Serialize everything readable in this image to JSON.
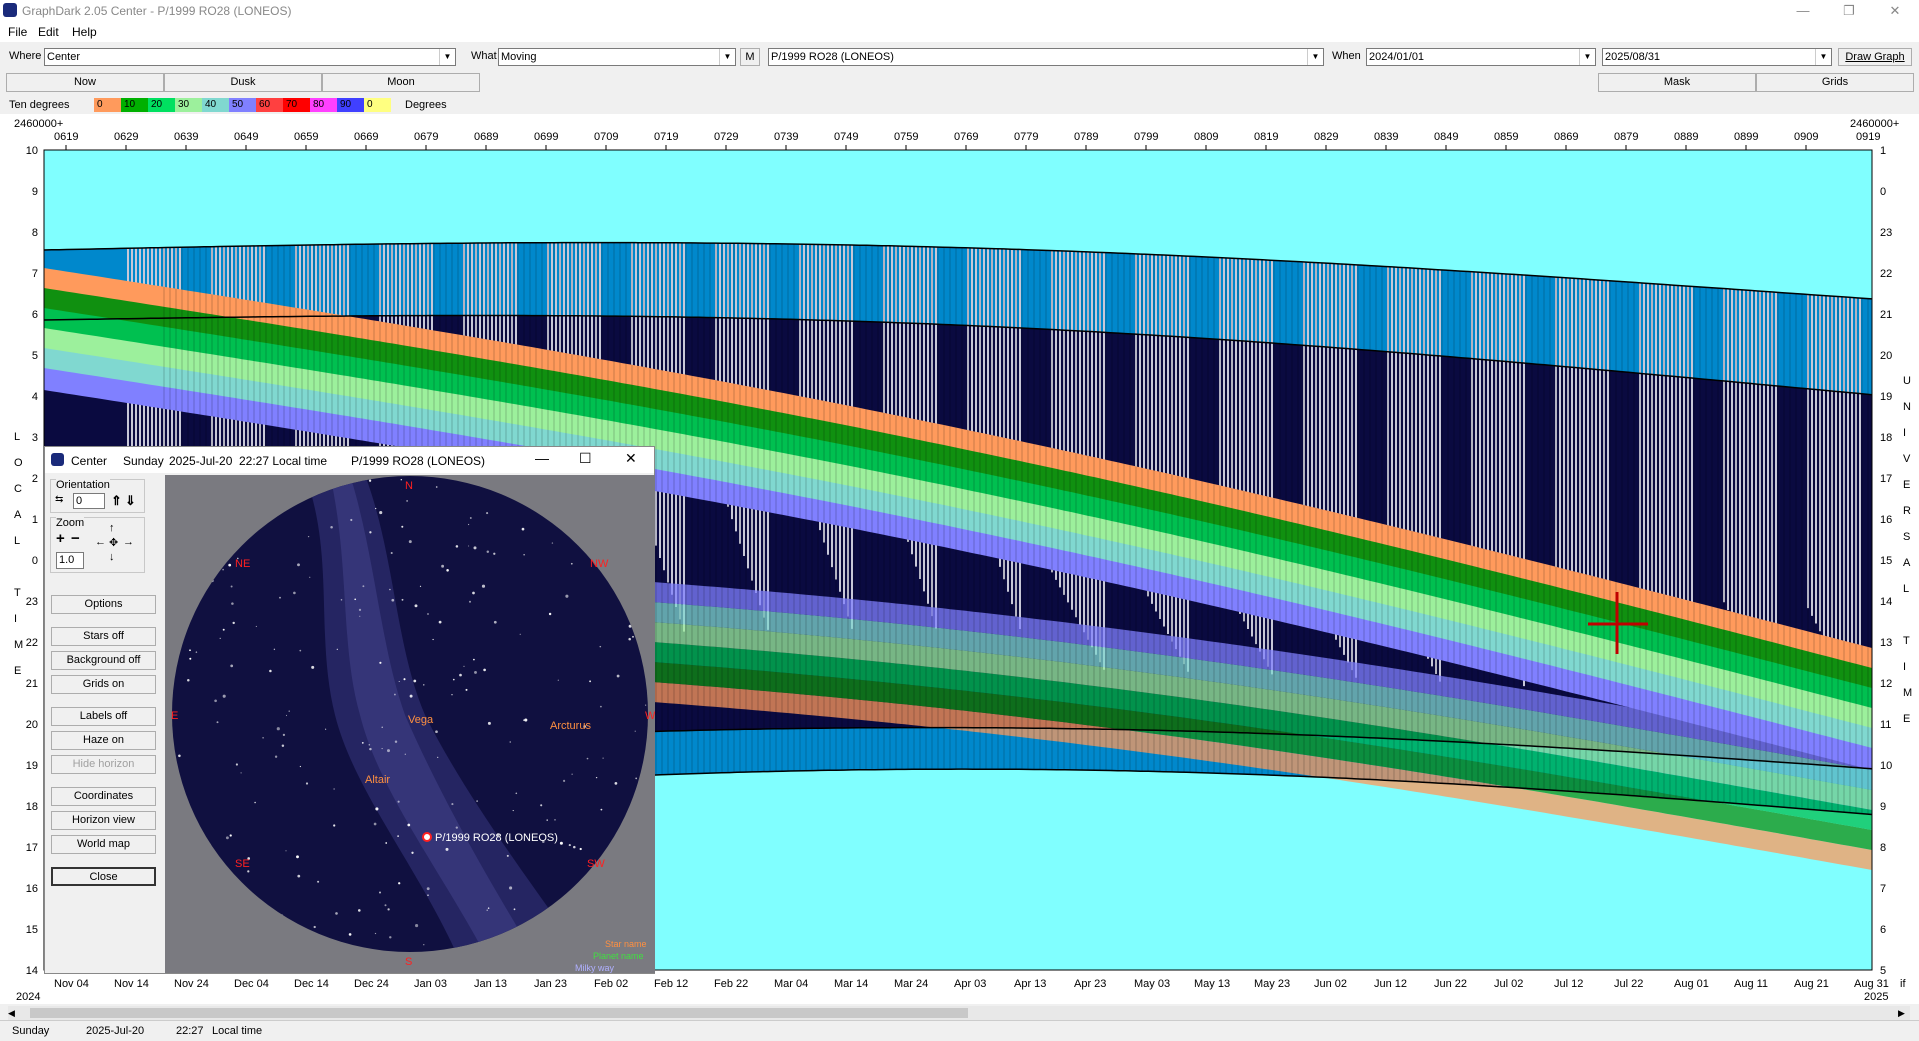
{
  "window": {
    "title": "GraphDark 2.05  Center  -  P/1999 RO28 (LONEOS)",
    "minimize": "—",
    "maximize": "❐",
    "close": "✕"
  },
  "menu": [
    "File",
    "Edit",
    "Help"
  ],
  "toolbar": {
    "where_label": "Where",
    "where_value": "Center",
    "what_label": "What",
    "what_value": "Moving",
    "m_button": "M",
    "object_value": "P/1999 RO28 (LONEOS)",
    "when_label": "When",
    "when_start": "2024/01/01",
    "when_end": "2025/08/31",
    "draw_button": "Draw Graph"
  },
  "tabs": {
    "now": "Now",
    "dusk": "Dusk",
    "moon": "Moon",
    "mask": "Mask",
    "grids": "Grids"
  },
  "legend": {
    "left_label": "Ten degrees",
    "right_label": "Degrees",
    "entries": [
      {
        "label": "0",
        "color": "#ff9a5c"
      },
      {
        "label": "10",
        "color": "#00b000"
      },
      {
        "label": "20",
        "color": "#00e060"
      },
      {
        "label": "30",
        "color": "#9cf09c"
      },
      {
        "label": "40",
        "color": "#80d8d0"
      },
      {
        "label": "50",
        "color": "#8080ff"
      },
      {
        "label": "60",
        "color": "#ff4040"
      },
      {
        "label": "70",
        "color": "#ff0000"
      },
      {
        "label": "80",
        "color": "#ff40ff"
      },
      {
        "label": "90",
        "color": "#4040ff"
      },
      {
        "label": "0",
        "color": "#ffff80"
      }
    ]
  },
  "chart": {
    "jd_left_label": "2460000+",
    "jd_right_label": "2460000+",
    "jd_right_value": "0919",
    "jd_ticks": [
      "0619",
      "0629",
      "0639",
      "0649",
      "0659",
      "0669",
      "0679",
      "0689",
      "0699",
      "0709",
      "0719",
      "0729",
      "0739",
      "0749",
      "0759",
      "0769",
      "0779",
      "0789",
      "0799",
      "0809",
      "0819",
      "0829",
      "0839",
      "0849",
      "0859",
      "0869",
      "0879",
      "0889",
      "0899",
      "0909"
    ],
    "left_ticks": [
      "10",
      "9",
      "8",
      "7",
      "6",
      "5",
      "4",
      "3",
      "2",
      "1",
      "0",
      "23",
      "22",
      "21",
      "20",
      "19",
      "18",
      "17",
      "16",
      "15",
      "14"
    ],
    "right_ticks": [
      "1",
      "0",
      "23",
      "22",
      "21",
      "20",
      "19",
      "18",
      "17",
      "16",
      "15",
      "14",
      "13",
      "12",
      "11",
      "10",
      "9",
      "8",
      "7",
      "6",
      "5"
    ],
    "left_axis_title": [
      "L",
      "O",
      "C",
      "A",
      "L",
      "",
      "T",
      "I",
      "M",
      "E"
    ],
    "right_axis_title": [
      "U",
      "N",
      "I",
      "V",
      "E",
      "R",
      "S",
      "A",
      "L",
      "",
      "T",
      "I",
      "M",
      "E"
    ],
    "date_ticks": [
      "Nov 04",
      "Nov 14",
      "Nov 24",
      "Dec 04",
      "Dec 14",
      "Dec 24",
      "Jan 03",
      "Jan 13",
      "Jan 23",
      "Feb 02",
      "Feb 12",
      "Feb 22",
      "Mar 04",
      "Mar 14",
      "Mar 24",
      "Apr 03",
      "Apr 13",
      "Apr 23",
      "May 03",
      "May 13",
      "May 23",
      "Jun 02",
      "Jun 12",
      "Jun 22",
      "Jul 02",
      "Jul 12",
      "Jul 22",
      "Aug 01",
      "Aug 11",
      "Aug 21",
      "Aug 31"
    ],
    "year_left": "2024",
    "year_right": "2025",
    "corner_label": "if",
    "colors": {
      "day": "#80ffff",
      "twilight": "#0088cc",
      "night": "#0a0a40",
      "moon": "#c8c8d8"
    }
  },
  "sky_window": {
    "title": "Center",
    "day": "Sunday",
    "date": "2025-Jul-20",
    "time": "22:27 Local time",
    "object": "P/1999 RO28 (LONEOS)",
    "orientation_label": "Orientation",
    "orientation_value": "0",
    "zoom_label": "Zoom",
    "zoom_value": "1.0",
    "buttons": [
      "Options",
      "Stars off",
      "Background off",
      "Grids on",
      "Labels off",
      "Haze on",
      "Hide horizon",
      "Coordinates",
      "Horizon view",
      "World map",
      "Close"
    ],
    "compass": [
      "N",
      "NW",
      "W",
      "SW",
      "S",
      "SE",
      "E",
      "NE"
    ],
    "stars": [
      "Vega",
      "Arcturus",
      "Altair"
    ],
    "comet_label": "P/1999 RO28 (LONEOS)",
    "key": [
      "Star name",
      "Planet name",
      "Milky way"
    ]
  },
  "status": {
    "day": "Sunday",
    "date": "2025-Jul-20",
    "time": "22:27",
    "time_label": "Local time"
  }
}
